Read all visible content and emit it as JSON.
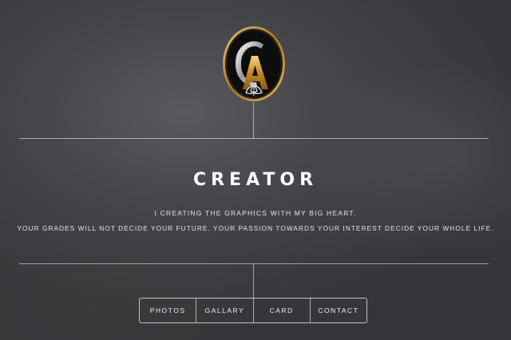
{
  "brand": {
    "logo_icon": "monogram-ca-logo-icon",
    "logo_letter": "A",
    "accent_gold": "#c9962e",
    "accent_silver": "#d8d8dc"
  },
  "hero": {
    "title": "CREATOR",
    "tagline_1": "I CREATING THE GRAPHICS WITH MY BIG HEART.",
    "tagline_2": "YOUR GRADES WILL NOT DECIDE YOUR FUTURE. YOUR PASSION TOWARDS YOUR INTEREST DECIDE YOUR WHOLE LIFE."
  },
  "nav": {
    "items": [
      {
        "label": "PHOTOS"
      },
      {
        "label": "GALLARY"
      },
      {
        "label": "CARD"
      },
      {
        "label": "CONTACT"
      }
    ]
  }
}
